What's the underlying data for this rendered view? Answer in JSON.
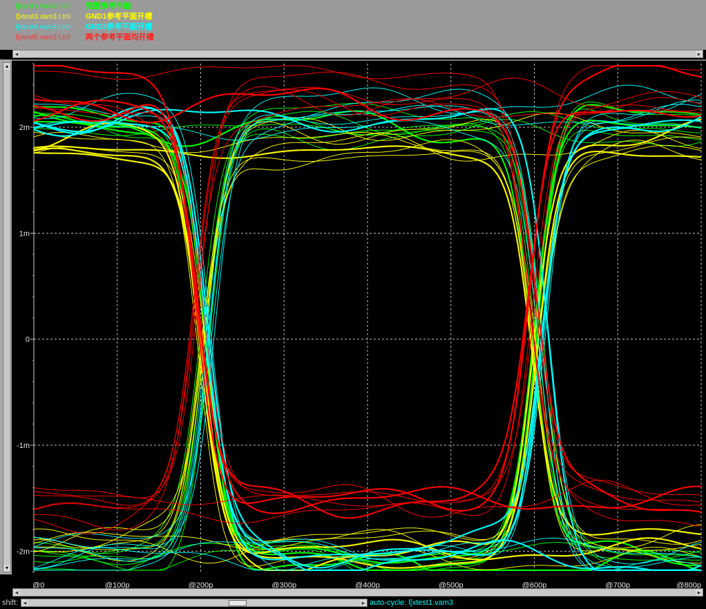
{
  "legend": [
    {
      "file": "l[xtest1.vam3 t.tr0",
      "desc": "完整参考平面",
      "color": "#00ff00"
    },
    {
      "file": "l[xtest3.vam3 t.tr0",
      "desc": "GND1参考平面开槽",
      "color": "#ffff00"
    },
    {
      "file": "l[xtest4.vam3 t.tr0",
      "desc": "GND2参考平面开槽",
      "color": "#00ffff"
    },
    {
      "file": "l[xtest5.vam3 t.tr0",
      "desc": "两个参考平面均开槽",
      "color": "#ff0000"
    }
  ],
  "status": {
    "shift_label": "shift:",
    "autocycle": "auto-cycle: l[xtest1.vam3"
  },
  "chart_data": {
    "type": "line",
    "title": "",
    "xlabel": "",
    "ylabel": "",
    "x_ticks": [
      "@0",
      "@100p",
      "@200p",
      "@300p",
      "@400p",
      "@500p",
      "@600p",
      "@700p",
      "@800p"
    ],
    "y_ticks": [
      "2m",
      "1m",
      "0",
      "-1m",
      "-2m"
    ],
    "xlim": [
      0,
      800
    ],
    "ylim": [
      -2.2,
      2.6
    ],
    "grid": true,
    "eye_crossings_ps": [
      205,
      605
    ],
    "series": [
      {
        "name": "完整参考平面",
        "color": "#00ff00",
        "high": 2.05,
        "low": -2.05,
        "cross_offset": 0
      },
      {
        "name": "GND1参考平面开槽",
        "color": "#ffff00",
        "high": 1.85,
        "low": -1.95,
        "cross_offset": -4
      },
      {
        "name": "GND2参考平面开槽",
        "color": "#00ffff",
        "high": 2.1,
        "low": -2.05,
        "cross_offset": 6
      },
      {
        "name": "两个参考平面均开槽",
        "color": "#ff0000",
        "high": 2.35,
        "low": -1.6,
        "cross_offset": -8
      }
    ]
  }
}
